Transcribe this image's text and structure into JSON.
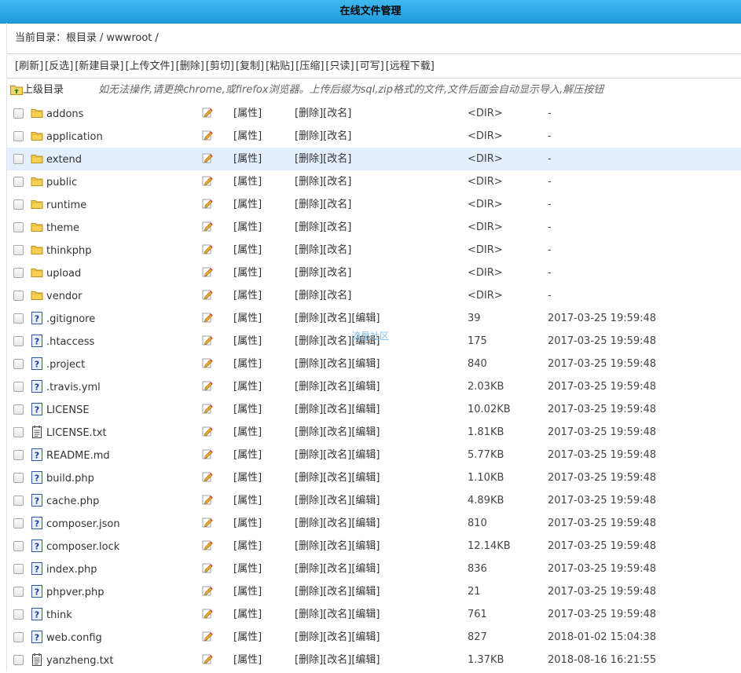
{
  "title": "在线文件管理",
  "path": {
    "label": "当前目录：",
    "root": "根目录",
    "sep": "/",
    "dir": "wwwroot",
    "trail": "/"
  },
  "toolbar": [
    "[刷新]",
    "[反选]",
    "[新建目录]",
    "[上传文件]",
    "[删除]",
    "[剪切]",
    "[复制]",
    "[粘贴]",
    "[压缩]",
    "[只读]",
    "[可写]",
    "[远程下载]"
  ],
  "up": {
    "label": "上级目录",
    "notice": "如无法操作,请更换chrome,或firefox浏览器。上传后缀为sql,zip格式的文件,文件后面会自动显示导入,解压按钮"
  },
  "labels": {
    "attr": "[属性]",
    "del": "[删除]",
    "rename": "[改名]",
    "edit": "[编辑]"
  },
  "watermark": "流星社区",
  "colors": {
    "title_bar": "#1f9bdc",
    "highlight_row": "#e3effd",
    "folder": "#f5c542"
  },
  "files": [
    {
      "name": "addons",
      "type": "dir",
      "size": "<DIR>",
      "date": "-"
    },
    {
      "name": "application",
      "type": "dir",
      "size": "<DIR>",
      "date": "-"
    },
    {
      "name": "extend",
      "type": "dir",
      "size": "<DIR>",
      "date": "-",
      "highlight": true
    },
    {
      "name": "public",
      "type": "dir",
      "size": "<DIR>",
      "date": "-"
    },
    {
      "name": "runtime",
      "type": "dir",
      "size": "<DIR>",
      "date": "-"
    },
    {
      "name": "theme",
      "type": "dir",
      "size": "<DIR>",
      "date": "-"
    },
    {
      "name": "thinkphp",
      "type": "dir",
      "size": "<DIR>",
      "date": "-"
    },
    {
      "name": "upload",
      "type": "dir",
      "size": "<DIR>",
      "date": "-"
    },
    {
      "name": "vendor",
      "type": "dir",
      "size": "<DIR>",
      "date": "-"
    },
    {
      "name": ".gitignore",
      "type": "unknown",
      "size": "39",
      "date": "2017-03-25 19:59:48"
    },
    {
      "name": ".htaccess",
      "type": "unknown",
      "size": "175",
      "date": "2017-03-25 19:59:48"
    },
    {
      "name": ".project",
      "type": "unknown",
      "size": "840",
      "date": "2017-03-25 19:59:48"
    },
    {
      "name": ".travis.yml",
      "type": "unknown",
      "size": "2.03KB",
      "date": "2017-03-25 19:59:48"
    },
    {
      "name": "LICENSE",
      "type": "unknown",
      "size": "10.02KB",
      "date": "2017-03-25 19:59:48"
    },
    {
      "name": "LICENSE.txt",
      "type": "text",
      "size": "1.81KB",
      "date": "2017-03-25 19:59:48"
    },
    {
      "name": "README.md",
      "type": "unknown",
      "size": "5.77KB",
      "date": "2017-03-25 19:59:48"
    },
    {
      "name": "build.php",
      "type": "unknown",
      "size": "1.10KB",
      "date": "2017-03-25 19:59:48"
    },
    {
      "name": "cache.php",
      "type": "unknown",
      "size": "4.89KB",
      "date": "2017-03-25 19:59:48"
    },
    {
      "name": "composer.json",
      "type": "unknown",
      "size": "810",
      "date": "2017-03-25 19:59:48"
    },
    {
      "name": "composer.lock",
      "type": "unknown",
      "size": "12.14KB",
      "date": "2017-03-25 19:59:48"
    },
    {
      "name": "index.php",
      "type": "unknown",
      "size": "836",
      "date": "2017-03-25 19:59:48"
    },
    {
      "name": "phpver.php",
      "type": "unknown",
      "size": "21",
      "date": "2017-03-25 19:59:48"
    },
    {
      "name": "think",
      "type": "unknown",
      "size": "761",
      "date": "2017-03-25 19:59:48"
    },
    {
      "name": "web.config",
      "type": "unknown",
      "size": "827",
      "date": "2018-01-02 15:04:38"
    },
    {
      "name": "yanzheng.txt",
      "type": "text",
      "size": "1.37KB",
      "date": "2018-08-16 16:21:55"
    }
  ]
}
